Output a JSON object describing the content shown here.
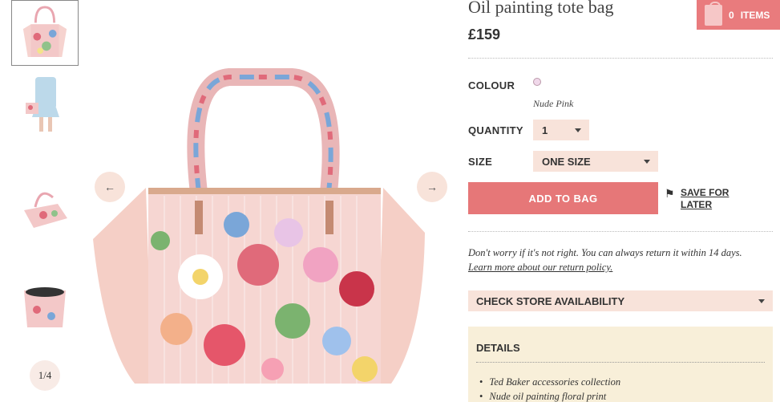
{
  "product": {
    "title": "Oil painting tote bag",
    "price": "£159",
    "colour_label": "COLOUR",
    "colour_name": "Nude Pink",
    "quantity_label": "QUANTITY",
    "quantity_value": "1",
    "size_label": "SIZE",
    "size_value": "ONE SIZE",
    "add_to_bag": "ADD TO BAG",
    "save_for_later": "SAVE FOR LATER",
    "returns_text": "Don't worry if it's not right. You can always return it within 14 days.",
    "returns_link": "Learn more about our return policy.",
    "check_store": "CHECK STORE AVAILABILITY",
    "details_title": "DETAILS",
    "details_items": [
      "Ted Baker accessories collection",
      "Nude oil painting floral print"
    ]
  },
  "bag": {
    "count": "0",
    "label": "ITEMS"
  },
  "gallery": {
    "counter": "1/4",
    "prev_icon": "arrow-left-icon",
    "next_icon": "arrow-right-icon"
  },
  "colors": {
    "accent": "#e67778",
    "panel_pink": "#f8e3da",
    "details_bg": "#f8efd9"
  }
}
